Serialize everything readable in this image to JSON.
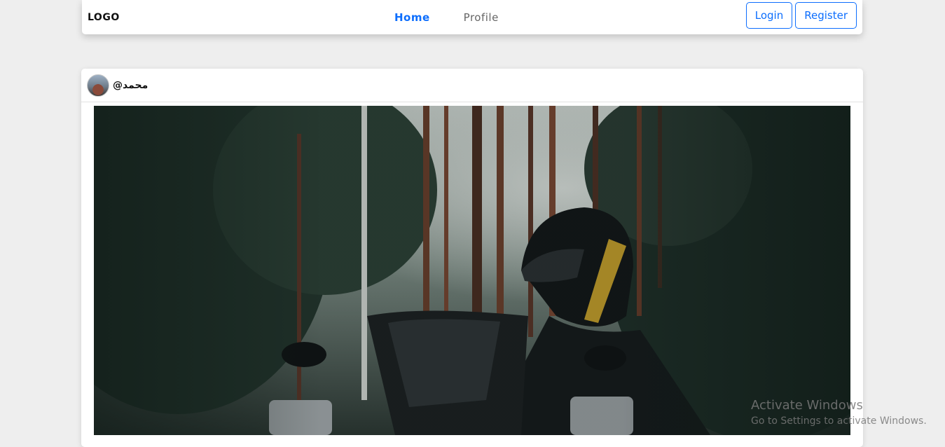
{
  "navbar": {
    "logo": "LOGO",
    "links": [
      {
        "label": "Home",
        "active": true
      },
      {
        "label": "Profile",
        "active": false
      }
    ],
    "login_label": "Login",
    "register_label": "Register"
  },
  "post": {
    "username": "@محمد",
    "image_alt": "motorcycle-rider-in-forest-photo"
  },
  "watermark": {
    "title": "Activate Windows",
    "subtitle": "Go to Settings to activate Windows."
  },
  "colors": {
    "accent": "#0d6efd",
    "background": "#eeeeee"
  }
}
